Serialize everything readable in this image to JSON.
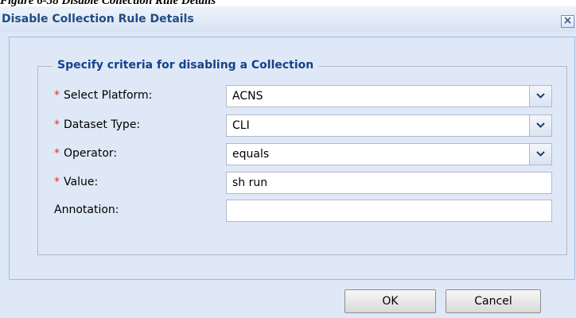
{
  "caption": "Figure 6-38        Disable Collection Rule Details",
  "dialog": {
    "title": "Disable Collection Rule Details",
    "close_symbol": "×",
    "fieldset_legend": "Specify criteria for disabling a Collection",
    "required_marker": "*",
    "fields": {
      "platform": {
        "label": "Select Platform:",
        "value": "ACNS",
        "required": true
      },
      "dataset_type": {
        "label": "Dataset Type:",
        "value": "CLI",
        "required": true
      },
      "operator": {
        "label": "Operator:",
        "value": "equals",
        "required": true
      },
      "value": {
        "label": "Value:",
        "value": "sh run",
        "required": true
      },
      "annotation": {
        "label": "Annotation:",
        "value": "",
        "required": false
      }
    },
    "buttons": {
      "ok": "OK",
      "cancel": "Cancel"
    }
  },
  "icons": {
    "close": "close-icon",
    "dropdown": "chevron-down-icon"
  },
  "colors": {
    "title": "#1f4c86",
    "legend": "#15428b",
    "required": "#e0312a",
    "panel_bg": "#dfe8f6"
  }
}
